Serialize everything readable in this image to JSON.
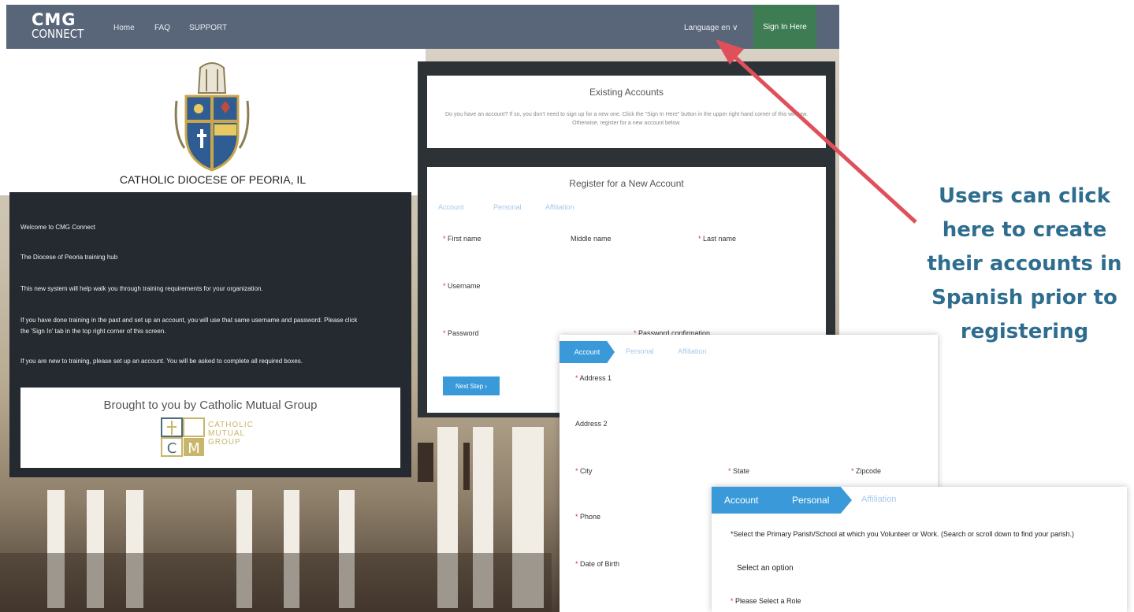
{
  "app": {
    "logo_line1": "CMG",
    "logo_line2": "CONNECT"
  },
  "nav": {
    "items": [
      {
        "label": "Home"
      },
      {
        "label": "FAQ"
      },
      {
        "label": "SUPPORT"
      }
    ],
    "language_label": "Language en ∨",
    "sign_in_label": "Sign In Here"
  },
  "diocese": {
    "name": "CATHOLIC DIOCESE OF PEORIA, IL"
  },
  "welcome": {
    "lines": [
      "Welcome to CMG Connect",
      "The Diocese of Peoria training hub",
      "This new system will help walk you through training requirements for your organization.",
      "If you have done training in the past and set up an account, you will use that same username and password. Please click",
      "the 'Sign In' tab in the top right corner of this screen.",
      "If you are new to training, please set up an account. You will be asked to complete all required boxes."
    ],
    "brought_by": "Brought to you by Catholic Mutual Group",
    "cm_logo_text": [
      "CATHOLIC",
      "MUTUAL",
      "GROUP"
    ]
  },
  "existing": {
    "title": "Existing Accounts",
    "text": "Do you have an account? If so, you don't need to sign up for a new one. Click the \"Sign In Here\" button in the upper right hand corner of this window. Otherwise, register for a new account below."
  },
  "register": {
    "title": "Register for a New Account",
    "tabs": [
      "Account",
      "Personal",
      "Affiliation"
    ],
    "first_name": "First name",
    "middle_name": "Middle name",
    "last_name": "Last name",
    "username": "Username",
    "password": "Password",
    "password_confirmation": "Password confirmation",
    "next_step": "Next Step ›"
  },
  "overlay1": {
    "tabs": [
      "Account",
      "Personal",
      "Affiliation"
    ],
    "address1": "Address 1",
    "address2": "Address 2",
    "city": "City",
    "state": "State",
    "zip": "Zipcode",
    "phone": "Phone",
    "dob": "Date of Birth"
  },
  "overlay2": {
    "tabs": [
      "Account",
      "Personal",
      "Affiliation"
    ],
    "question": "*Select the Primary Parish/School at which you Volunteer or Work. (Search or scroll down to find your parish.)",
    "select_placeholder": "Select an option",
    "role_label": "Please Select a Role"
  },
  "callout": {
    "lines": [
      "Users can click",
      "here to create",
      "their accounts in",
      "Spanish prior to",
      "registering"
    ],
    "color": "#2f6d8f"
  },
  "colors": {
    "topbar": "#59667a",
    "signin": "#3e7c54",
    "accent": "#3a9ad9",
    "arrow": "#e0505a"
  }
}
